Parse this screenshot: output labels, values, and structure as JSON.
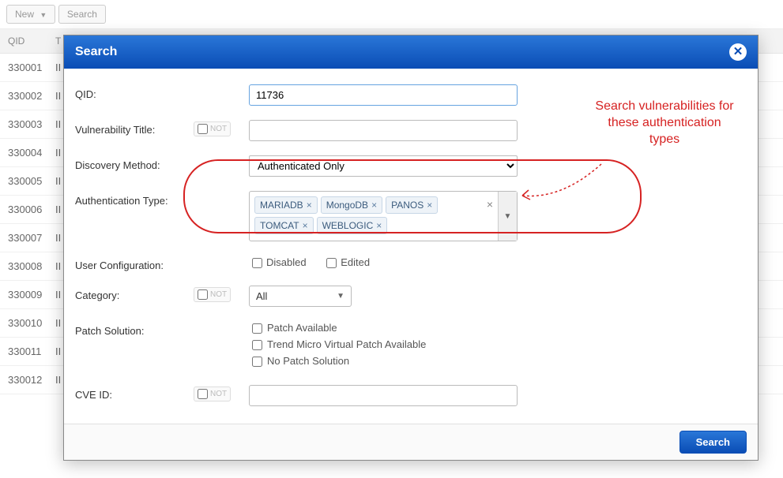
{
  "bg": {
    "new_btn": "New",
    "search_btn": "Search",
    "headers": {
      "qid": "QID",
      "title": "T"
    },
    "rows": [
      {
        "qid": "330001",
        "rest": "II"
      },
      {
        "qid": "330002",
        "rest": "II"
      },
      {
        "qid": "330003",
        "rest": "II"
      },
      {
        "qid": "330004",
        "rest": "II"
      },
      {
        "qid": "330005",
        "rest": "II"
      },
      {
        "qid": "330006",
        "rest": "II"
      },
      {
        "qid": "330007",
        "rest": "II"
      },
      {
        "qid": "330008",
        "rest": "II"
      },
      {
        "qid": "330009",
        "rest": "II"
      },
      {
        "qid": "330010",
        "rest": "II"
      },
      {
        "qid": "330011",
        "rest": "II"
      },
      {
        "qid": "330012",
        "rest": "II"
      }
    ]
  },
  "modal": {
    "title": "Search",
    "footer_search": "Search",
    "fields": {
      "qid_label": "QID:",
      "qid_value": "11736",
      "vuln_title_label": "Vulnerability Title:",
      "not_label": "NOT",
      "discovery_label": "Discovery Method:",
      "discovery_value": "Authenticated Only",
      "auth_type_label": "Authentication Type:",
      "auth_tags": [
        "MARIADB",
        "MongoDB",
        "PANOS",
        "TOMCAT",
        "WEBLOGIC"
      ],
      "user_config_label": "User Configuration:",
      "user_config_opts": {
        "disabled": "Disabled",
        "edited": "Edited"
      },
      "category_label": "Category:",
      "category_value": "All",
      "patch_label": "Patch Solution:",
      "patch_opts": {
        "available": "Patch Available",
        "trendmicro": "Trend Micro Virtual Patch Available",
        "none": "No Patch Solution"
      },
      "cve_label": "CVE ID:"
    }
  },
  "annotation": {
    "line1": "Search vulnerabilities for",
    "line2": "these authentication",
    "line3": "types"
  }
}
